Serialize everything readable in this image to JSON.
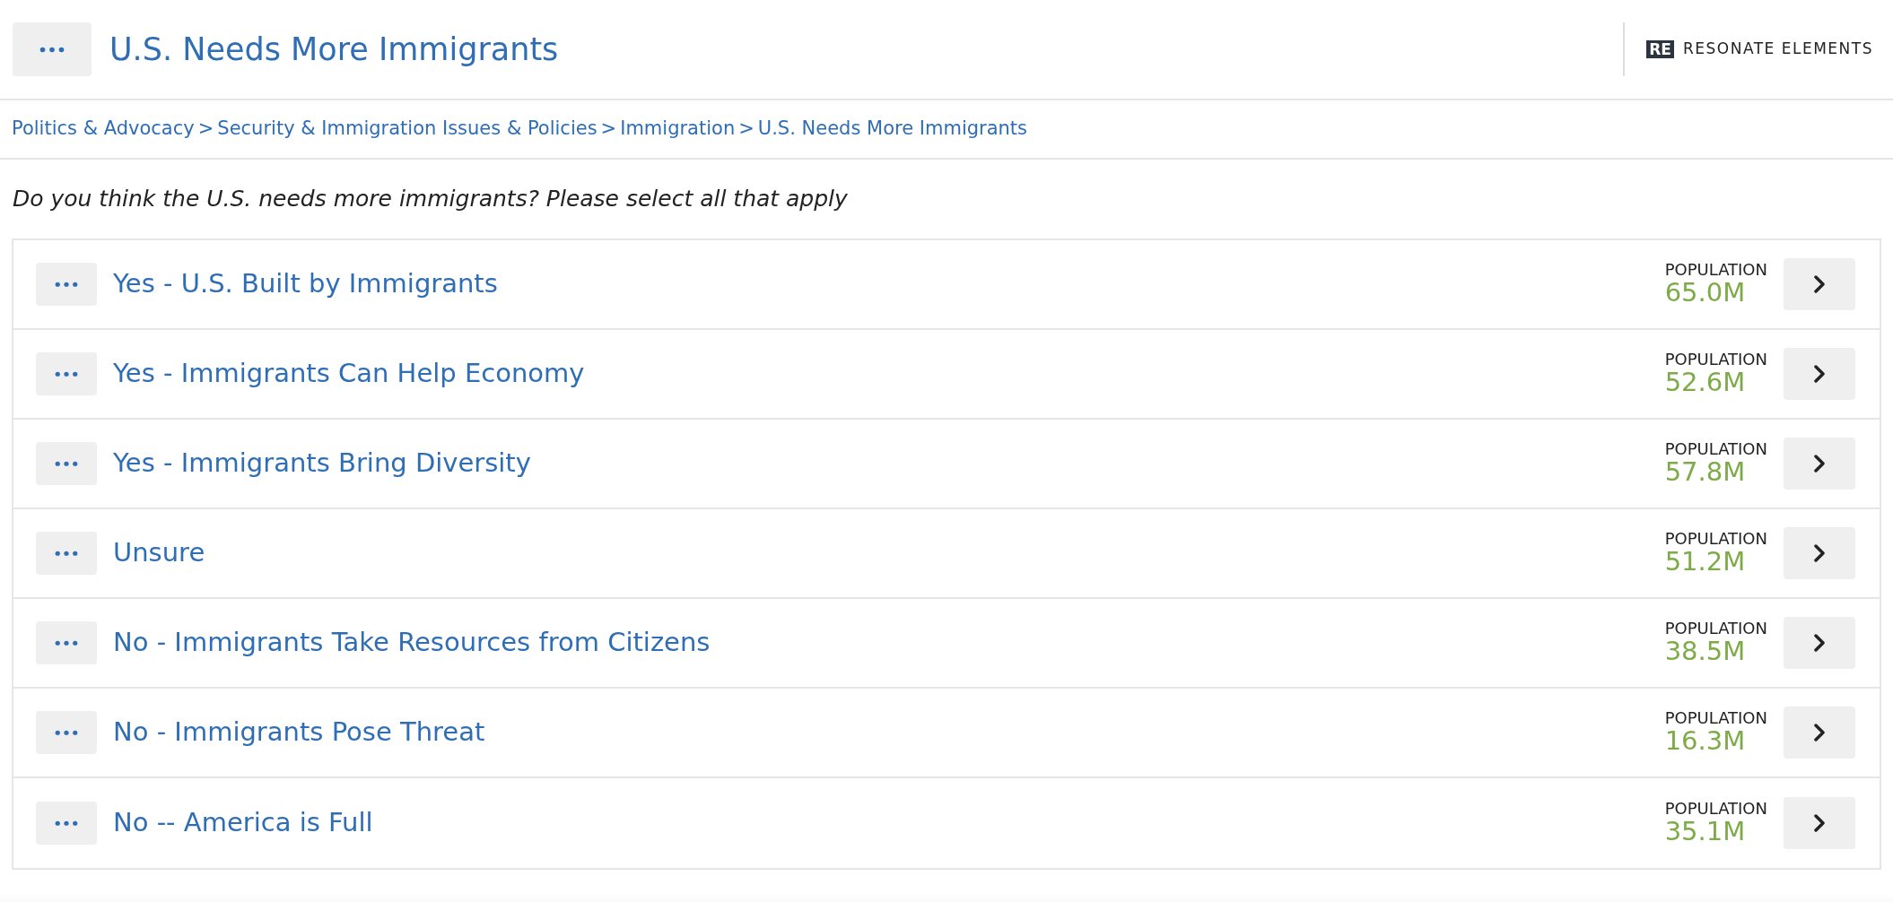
{
  "header": {
    "title": "U.S. Needs More Immigrants",
    "logo_mark": "RE",
    "logo_text": "RESONATE ELEMENTS"
  },
  "breadcrumb": [
    {
      "label": "Politics & Advocacy"
    },
    {
      "label": "Security & Immigration Issues & Policies"
    },
    {
      "label": "Immigration"
    },
    {
      "label": "U.S. Needs More Immigrants"
    }
  ],
  "breadcrumb_separator": ">",
  "question": "Do you think the U.S. needs more immigrants? Please select all that apply",
  "answers": [
    {
      "label": "Yes - U.S. Built by Immigrants",
      "stat_label": "POPULATION",
      "value": "65.0M"
    },
    {
      "label": "Yes - Immigrants Can Help Economy",
      "stat_label": "POPULATION",
      "value": "52.6M"
    },
    {
      "label": "Yes - Immigrants Bring Diversity",
      "stat_label": "POPULATION",
      "value": "57.8M"
    },
    {
      "label": "Unsure",
      "stat_label": "POPULATION",
      "value": "51.2M"
    },
    {
      "label": "No - Immigrants Take Resources from Citizens",
      "stat_label": "POPULATION",
      "value": "38.5M"
    },
    {
      "label": "No - Immigrants Pose Threat",
      "stat_label": "POPULATION",
      "value": "16.3M"
    },
    {
      "label": "No -- America is Full",
      "stat_label": "POPULATION",
      "value": "35.1M"
    }
  ]
}
